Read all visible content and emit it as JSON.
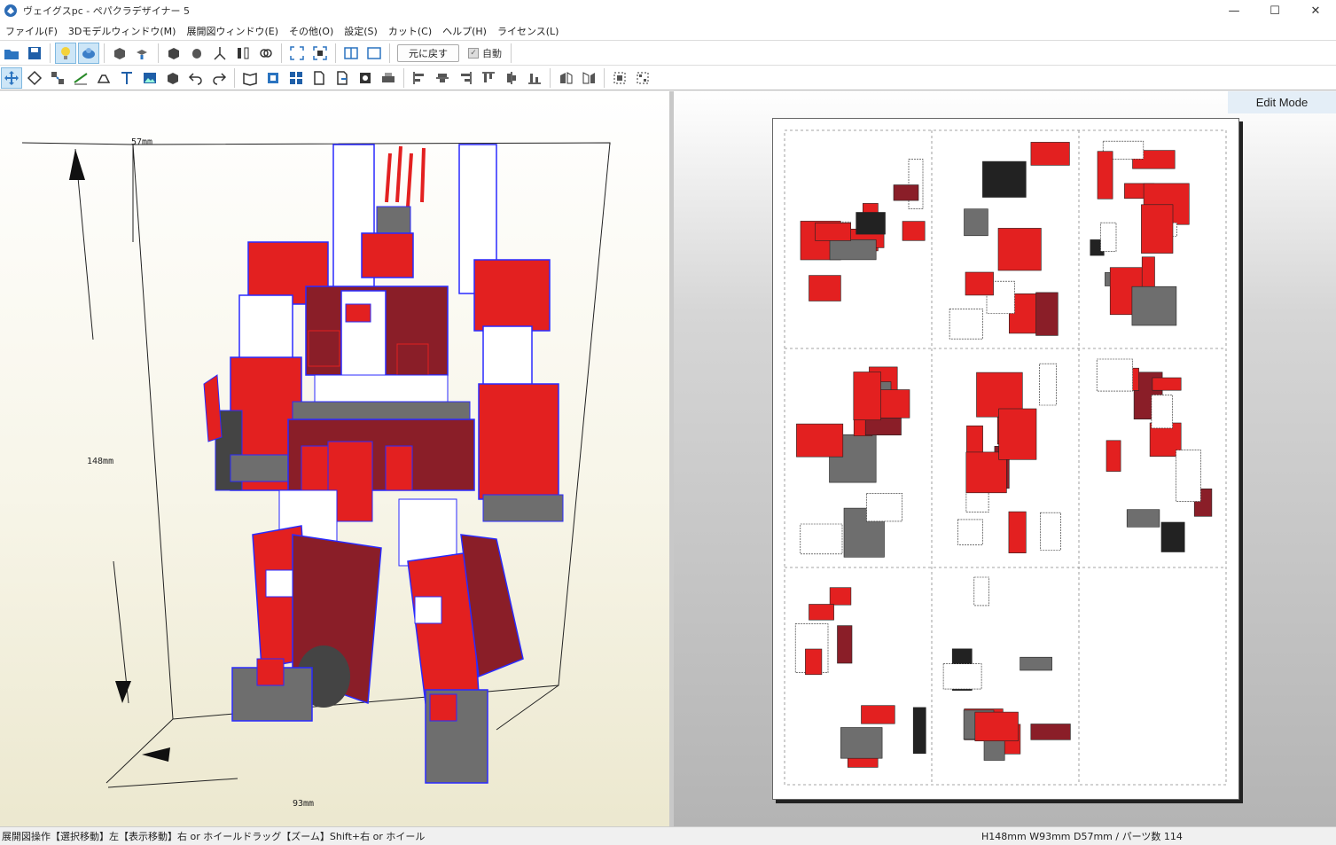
{
  "window": {
    "title": "ヴェイグスpc - ペパクラデザイナー 5",
    "controls": [
      "—",
      "☐",
      "✕"
    ]
  },
  "menu": [
    "ファイル(F)",
    "3Dモデルウィンドウ(M)",
    "展開図ウィンドウ(E)",
    "その他(O)",
    "設定(S)",
    "カット(C)",
    "ヘルプ(H)",
    "ライセンス(L)"
  ],
  "toolbar1": {
    "undo_label": "元に戻す",
    "auto_label": "自動",
    "icons": [
      "open-icon",
      "save-icon",
      "light-icon",
      "texture-icon",
      "edit-3d-icon",
      "join-icon",
      "box-icon",
      "cylinder-icon",
      "axis-icon",
      "mirror-icon",
      "link-icon",
      "fit-icon",
      "fit-select-icon",
      "split-view-icon",
      "single-view-icon"
    ]
  },
  "toolbar2": {
    "icons": [
      "select-move-icon",
      "rotate-icon",
      "join-edge-icon",
      "fold-line-icon",
      "flap-icon",
      "text-icon",
      "image-icon",
      "cube-icon",
      "undo-icon",
      "redo-icon",
      "book-icon",
      "fit-page-icon",
      "grid-icon",
      "page-icon",
      "export-icon",
      "print-preview-icon",
      "print-icon",
      "align-left-icon",
      "align-center-icon",
      "align-right-icon",
      "align-top-icon",
      "align-middle-icon",
      "align-bottom-icon",
      "flip-h-icon",
      "flip-v-icon",
      "group-icon",
      "ungroup-icon"
    ]
  },
  "view3d": {
    "dim_depth": "57mm",
    "dim_height": "148mm",
    "dim_width": "93mm"
  },
  "view2d": {
    "mode": "Edit Mode"
  },
  "colors": {
    "red": "#e32020",
    "dark_red": "#8a1e28",
    "gray": "#6e6e6e",
    "dark": "#222222",
    "edge_blue": "#2a2aff"
  },
  "status": {
    "help": "展開図操作【選択移動】左【表示移動】右 or ホイールドラッグ【ズーム】Shift+右 or ホイール",
    "info": "H148mm W93mm D57mm / パーツ数 114"
  }
}
